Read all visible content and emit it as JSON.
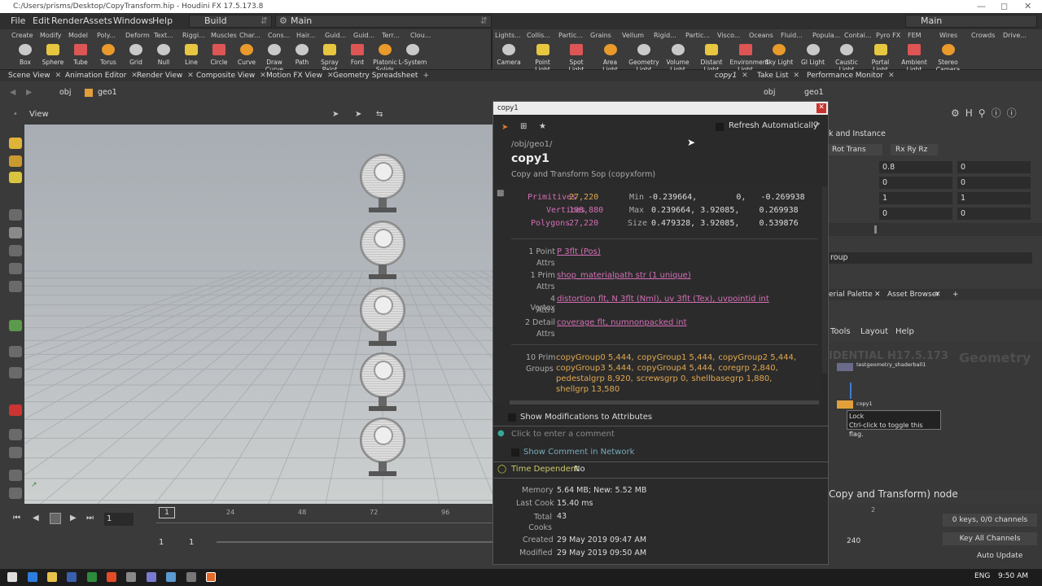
{
  "window": {
    "title": "C:/Users/prisms/Desktop/CopyTransform.hip - Houdini FX 17.5.173.8"
  },
  "menubar": {
    "items": [
      "File",
      "Edit",
      "Render",
      "Assets",
      "Windows",
      "Help"
    ],
    "desktop": "Build",
    "main": "Main",
    "main_right": "Main"
  },
  "shelf_left": {
    "tabs": [
      "Create",
      "Modify",
      "Model",
      "Poly...",
      "Deform",
      "Text...",
      "Riggi...",
      "Muscles",
      "Char...",
      "Cons...",
      "Hair...",
      "Guid...",
      "Guid...",
      "Terr...",
      "Clou..."
    ],
    "tools": [
      "Box",
      "Sphere",
      "Tube",
      "Torus",
      "Grid",
      "Null",
      "Line",
      "Circle",
      "Curve",
      "Draw Curve",
      "Path",
      "Spray Paint",
      "Font",
      "Platonic Solids",
      "L-System"
    ]
  },
  "shelf_right": {
    "tabs": [
      "Lights...",
      "Collis...",
      "Partic...",
      "Grains",
      "Vellum",
      "Rigid...",
      "Partic...",
      "Visco...",
      "Oceans",
      "Fluid...",
      "Popula...",
      "Contai...",
      "Pyro FX",
      "FEM",
      "Wires",
      "Crowds",
      "Drive..."
    ],
    "tools": [
      "Camera",
      "Point Light",
      "Spot Light",
      "Area Light",
      "Geometry Light",
      "Volume Light",
      "Distant Light",
      "Environment Light",
      "Sky Light",
      "GI Light",
      "Caustic Light",
      "Portal Light",
      "Ambient Light",
      "Stereo Camera"
    ]
  },
  "pane_tabs": [
    "Scene View",
    "Animation Editor",
    "Render View",
    "Composite View",
    "Motion FX View",
    "Geometry Spreadsheet"
  ],
  "right_tabs": [
    "copy1",
    "Take List",
    "Performance Monitor"
  ],
  "path": {
    "obj": "obj",
    "geo": "geo1"
  },
  "viewer": {
    "label": "View"
  },
  "timeline": {
    "ticks": [
      "24",
      "48",
      "72",
      "96"
    ],
    "frame": "1",
    "start": "1",
    "end": "1"
  },
  "popup": {
    "title": "copy1",
    "refresh": "Refresh Automatically",
    "path": "/obj/geo1/",
    "node": "copy1",
    "type": "Copy and Transform Sop (copyxform)",
    "stats": {
      "prim_label": "Primitives",
      "prim_val": "27,220",
      "vert_label": "Vertices",
      "vert_val": "108,880",
      "poly_label": "Polygons",
      "poly_val": "27,220",
      "min_label": "Min",
      "min_val": "-0.239664,        0,   -0.269938",
      "max_label": "Max",
      "max_val": "0.239664, 3.92085,    0.269938",
      "size_label": "Size",
      "size_val": "0.479328, 3.92085,    0.539876"
    },
    "attrs": [
      {
        "count": "1 Point",
        "sub": "Attrs",
        "text": "P 3flt (Pos)"
      },
      {
        "count": "1 Prim",
        "sub": "Attrs",
        "text": "shop_materialpath str (1 unique)"
      },
      {
        "count": "4 Vertex",
        "sub": "Attrs",
        "text": "distortion flt, N 3flt (Nml), uv 3flt (Tex), uvpointid int"
      },
      {
        "count": "2 Detail",
        "sub": "Attrs",
        "text": "coverage flt, numnonpacked int"
      }
    ],
    "groups_count": "10 Prim",
    "groups_sub": "Groups",
    "groups": [
      "copyGroup0 5,444,",
      "copyGroup1 5,444,",
      "copyGroup2 5,444,",
      "copyGroup3 5,444,",
      "copyGroup4 5,444,",
      "coregrp 2,840,",
      "pedestalgrp 8,920,",
      "screwsgrp 0,",
      "shellbasegrp 1,880,",
      "shellgrp 13,580"
    ],
    "show_mods": "Show Modifications to Attributes",
    "comment_placeholder": "Click to enter a comment",
    "show_comment": "Show Comment in Network",
    "time_dep_label": "Time Dependent",
    "time_dep_val": "No",
    "memory_label": "Memory",
    "memory_val": "5.64 MB; New: 5.52 MB",
    "lastcook_label": "Last Cook",
    "lastcook_val": "15.40 ms",
    "totalcooks_label": "Total Cooks",
    "totalcooks_val": "43",
    "created_label": "Created",
    "created_val": "29 May 2019 09:47 AM",
    "modified_label": "Modified",
    "modified_val": "29 May 2019 09:50 AM"
  },
  "params": {
    "section": "k and Instance",
    "rot_trans": "Rot Trans",
    "rx_ry_rz": "Rx Ry Rz",
    "rows": [
      [
        "0.8",
        "0"
      ],
      [
        "0",
        "0"
      ],
      [
        "1",
        "1"
      ],
      [
        "0",
        "0"
      ]
    ],
    "group_field": "roup"
  },
  "network": {
    "tabs": [
      "erial Palette",
      "Asset Browser"
    ],
    "menu": [
      "Tools",
      "Layout",
      "Help"
    ],
    "watermark": "IDENTIAL H17.5.173",
    "geometry": "Geometry",
    "node1": "testgeometry_shaderball1",
    "node2": "copy1",
    "tooltip_title": "Lock",
    "tooltip_text": "Ctrl-click to toggle this flag.",
    "bottom_text": "Copy and Transform) node"
  },
  "channels": {
    "keys": "0 keys, 0/0 channels",
    "keyall": "Key All Channels",
    "end": "240",
    "autoupdate": "Auto Update",
    "marker": "2"
  },
  "taskbar": {
    "lang": "ENG",
    "time": "9:50 AM"
  }
}
